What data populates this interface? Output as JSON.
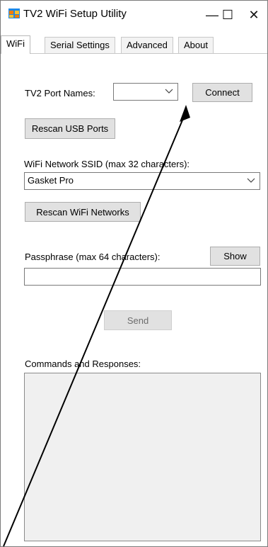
{
  "window": {
    "title": "TV2 WiFi Setup Utility",
    "minimize_glyph": "—",
    "maximize_glyph": "☐",
    "close_glyph": "✕",
    "app_icon": "app-window-icon"
  },
  "tabs": [
    {
      "label": "WiFi",
      "active": true
    },
    {
      "label": "Serial Settings",
      "active": false
    },
    {
      "label": "Advanced",
      "active": false
    },
    {
      "label": "About",
      "active": false
    }
  ],
  "wifi": {
    "port_label": "TV2 Port Names:",
    "port_value": "",
    "connect_label": "Connect",
    "rescan_usb_label": "Rescan USB Ports",
    "ssid_label": "WiFi Network SSID (max 32 characters):",
    "ssid_value": "Gasket Pro",
    "rescan_wifi_label": "Rescan WiFi Networks",
    "passphrase_label": "Passphrase (max 64 characters):",
    "show_label": "Show",
    "passphrase_value": "",
    "send_label": "Send",
    "commands_label": "Commands and Responses:",
    "commands_value": ""
  },
  "colors": {
    "button_face": "#e1e1e1",
    "log_background": "#f0f0f0",
    "annotation": "#000000"
  },
  "icons": {
    "dropdown": "chevron-down-icon",
    "annotation": "arrow-annotation"
  }
}
